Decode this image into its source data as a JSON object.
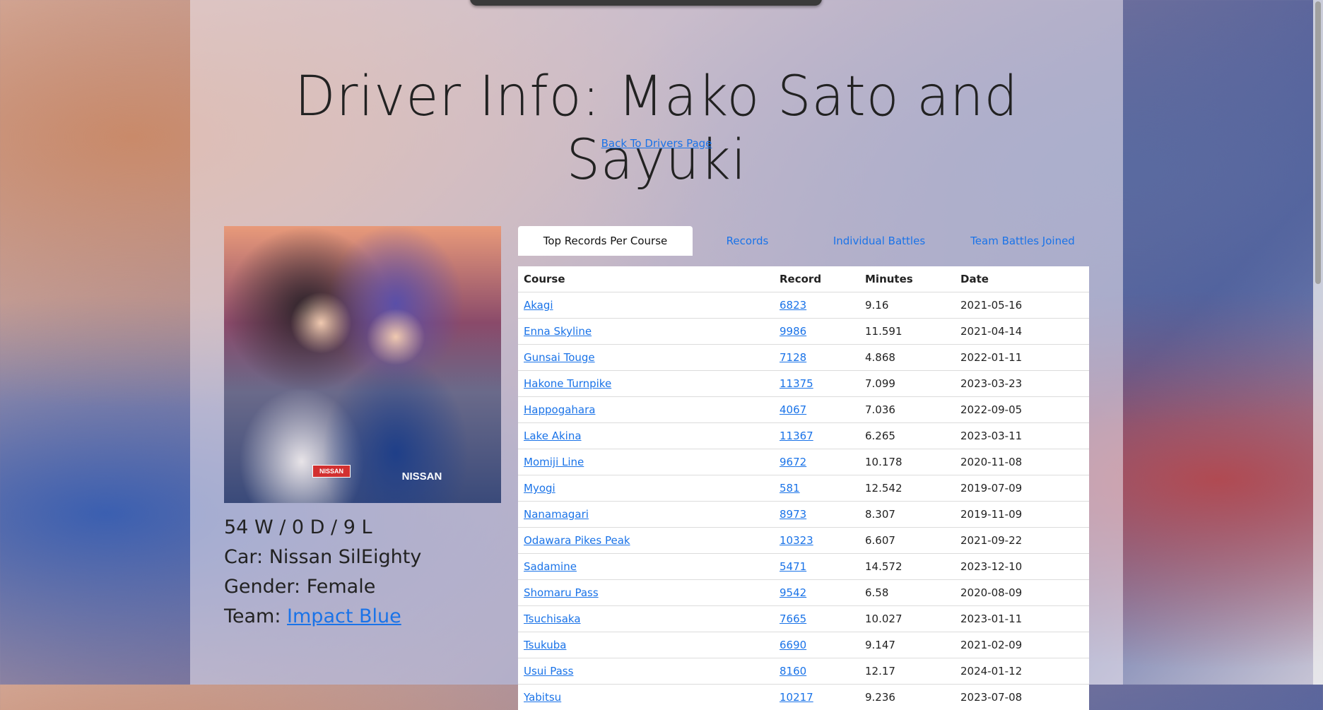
{
  "page": {
    "title": "Driver Info: Mako Sato and Sayuki",
    "back_link": "Back To Drivers Page"
  },
  "photo": {
    "badge_left": "NISSAN",
    "badge_right": "NISSAN"
  },
  "driver": {
    "record": "54 W / 0 D / 9 L",
    "car": "Car: Nissan SilEighty",
    "gender": "Gender: Female",
    "team_prefix": "Team: ",
    "team_name": "Impact Blue"
  },
  "tabs": [
    {
      "label": "Top Records Per Course",
      "active": true
    },
    {
      "label": "Records",
      "active": false
    },
    {
      "label": "Individual Battles",
      "active": false
    },
    {
      "label": "Team Battles Joined",
      "active": false
    }
  ],
  "table": {
    "headers": [
      "Course",
      "Record",
      "Minutes",
      "Date"
    ],
    "rows": [
      {
        "course": "Akagi",
        "record": "6823",
        "minutes": "9.16",
        "date": "2021-05-16"
      },
      {
        "course": "Enna Skyline",
        "record": "9986",
        "minutes": "11.591",
        "date": "2021-04-14"
      },
      {
        "course": "Gunsai Touge",
        "record": "7128",
        "minutes": "4.868",
        "date": "2022-01-11"
      },
      {
        "course": "Hakone Turnpike",
        "record": "11375",
        "minutes": "7.099",
        "date": "2023-03-23"
      },
      {
        "course": "Happogahara",
        "record": "4067",
        "minutes": "7.036",
        "date": "2022-09-05"
      },
      {
        "course": "Lake Akina",
        "record": "11367",
        "minutes": "6.265",
        "date": "2023-03-11"
      },
      {
        "course": "Momiji Line",
        "record": "9672",
        "minutes": "10.178",
        "date": "2020-11-08"
      },
      {
        "course": "Myogi",
        "record": "581",
        "minutes": "12.542",
        "date": "2019-07-09"
      },
      {
        "course": "Nanamagari",
        "record": "8973",
        "minutes": "8.307",
        "date": "2019-11-09"
      },
      {
        "course": "Odawara Pikes Peak",
        "record": "10323",
        "minutes": "6.607",
        "date": "2021-09-22"
      },
      {
        "course": "Sadamine",
        "record": "5471",
        "minutes": "14.572",
        "date": "2023-12-10"
      },
      {
        "course": "Shomaru Pass",
        "record": "9542",
        "minutes": "6.58",
        "date": "2020-08-09"
      },
      {
        "course": "Tsuchisaka",
        "record": "7665",
        "minutes": "10.027",
        "date": "2023-01-11"
      },
      {
        "course": "Tsukuba",
        "record": "6690",
        "minutes": "9.147",
        "date": "2021-02-09"
      },
      {
        "course": "Usui Pass",
        "record": "8160",
        "minutes": "12.17",
        "date": "2024-01-12"
      },
      {
        "course": "Yabitsu",
        "record": "10217",
        "minutes": "9.236",
        "date": "2023-07-08"
      }
    ]
  }
}
